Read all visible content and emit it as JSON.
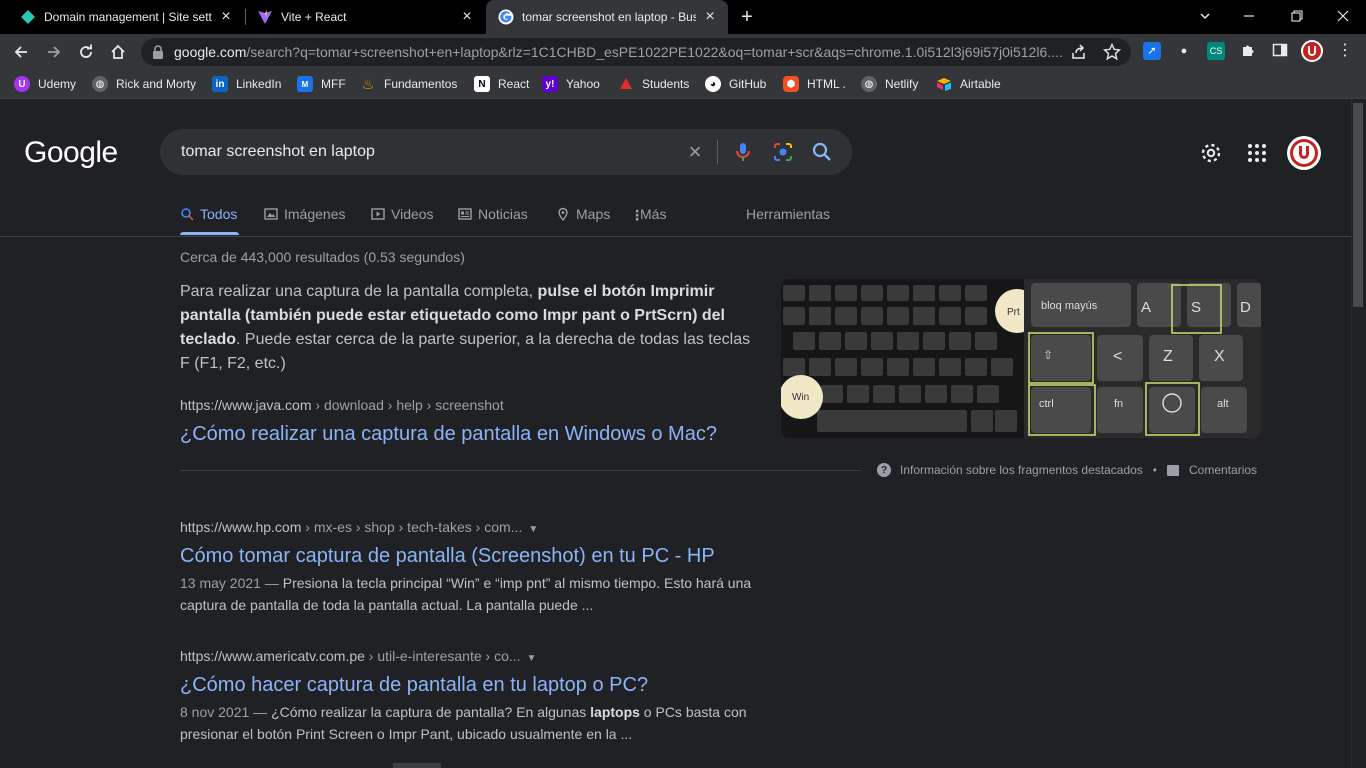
{
  "browser": {
    "tabs": [
      {
        "title": "Domain management | Site setting",
        "favicon": "netlify-diamond-icon",
        "active": false
      },
      {
        "title": "Vite + React",
        "favicon": "vite-icon",
        "active": false
      },
      {
        "title": "tomar screenshot en laptop - Busc",
        "favicon": "google-g-icon",
        "active": true
      }
    ],
    "new_tab_label": "+",
    "url_host": "google.com",
    "url_rest": "/search?q=tomar+screenshot+en+laptop&rlz=1C1CHBD_esPE1022PE1022&oq=tomar+scr&aqs=chrome.1.0i512l3j69i57j0i512l6....",
    "bookmarks": [
      {
        "label": "Udemy",
        "icon": "udemy-icon",
        "color": "#a435f0"
      },
      {
        "label": "Rick and Morty",
        "icon": "globe-icon",
        "color": "#5f6368"
      },
      {
        "label": "LinkedIn",
        "icon": "linkedin-icon",
        "color": "#0a66c2"
      },
      {
        "label": "MFF",
        "icon": "mff-icon",
        "color": "#1a73e8"
      },
      {
        "label": "Fundamentos",
        "icon": "fire-icon",
        "color": "#f29900"
      },
      {
        "label": "React",
        "icon": "notion-icon",
        "color": "#ffffff"
      },
      {
        "label": "Yahoo",
        "icon": "yahoo-icon",
        "color": "#6001d2"
      },
      {
        "label": "Students",
        "icon": "students-icon",
        "color": "#d93025"
      },
      {
        "label": "GitHub",
        "icon": "github-icon",
        "color": "#ffffff"
      },
      {
        "label": "HTML .",
        "icon": "html-icon",
        "color": "#f25022"
      },
      {
        "label": "Netlify",
        "icon": "globe-icon",
        "color": "#5f6368"
      },
      {
        "label": "Airtable",
        "icon": "airtable-icon",
        "color": "#fcb400"
      }
    ]
  },
  "google": {
    "logo": "Google",
    "query": "tomar screenshot en laptop",
    "tabs": [
      {
        "label": "Todos",
        "icon": "search-icon",
        "active": true
      },
      {
        "label": "Imágenes",
        "icon": "image-icon",
        "active": false
      },
      {
        "label": "Videos",
        "icon": "video-icon",
        "active": false
      },
      {
        "label": "Noticias",
        "icon": "news-icon",
        "active": false
      },
      {
        "label": "Maps",
        "icon": "map-pin-icon",
        "active": false
      },
      {
        "label": "Más",
        "icon": "more-vert-icon",
        "active": false
      }
    ],
    "tools_label": "Herramientas",
    "stats": "Cerca de 443,000 resultados (0.53 segundos)",
    "featured": {
      "text_1": "Para realizar una captura de la pantalla completa, ",
      "bold": "pulse el botón Imprimir pantalla (también puede estar etiquetado como Impr pant o PrtScrn) del teclado",
      "text_2": ". Puede estar cerca de la parte superior, a la derecha de todas las teclas F (F1, F2, etc.)",
      "cite_host": "https://www.java.com",
      "cite_path": " › download › help › screenshot",
      "title": "¿Cómo realizar una captura de pantalla en Windows o Mac?",
      "about_label": "Información sobre los fragmentos destacados",
      "bullet": "•",
      "feedback_label": "Comentarios",
      "image_labels": {
        "prt": "Prt",
        "win": "Win",
        "bloq": "bloq mayús",
        "a": "A",
        "s": "S",
        "d": "D",
        "lt": "<",
        "z": "Z",
        "x": "X",
        "ctrl": "ctrl",
        "fn": "fn",
        "alt": "alt"
      }
    },
    "results": [
      {
        "cite_host": "https://www.hp.com",
        "cite_path": " › mx-es › shop › tech-takes › com...",
        "title": "Cómo tomar captura de pantalla (Screenshot) en tu PC - HP",
        "date": "13 may 2021 — ",
        "desc_1": "Presiona la tecla principal “Win” e “imp pnt” al mismo tiempo. Esto hará una captura de pantalla de toda la pantalla actual. La pantalla puede ...",
        "desc_bold": "",
        "desc_2": ""
      },
      {
        "cite_host": "https://www.americatv.com.pe",
        "cite_path": " › util-e-interesante › co...",
        "title": "¿Cómo hacer captura de pantalla en tu laptop o PC?",
        "date": "8 nov 2021 — ",
        "desc_1": "¿Cómo realizar la captura de pantalla? En algunas ",
        "desc_bold": "laptops",
        "desc_2": " o PCs basta con presionar el botón Print Screen o Impr Pant, ubicado usualmente en la ..."
      }
    ],
    "colors": {
      "link": "#8ab4f8",
      "bg": "#202124",
      "accent_red": "#c5221f"
    }
  }
}
